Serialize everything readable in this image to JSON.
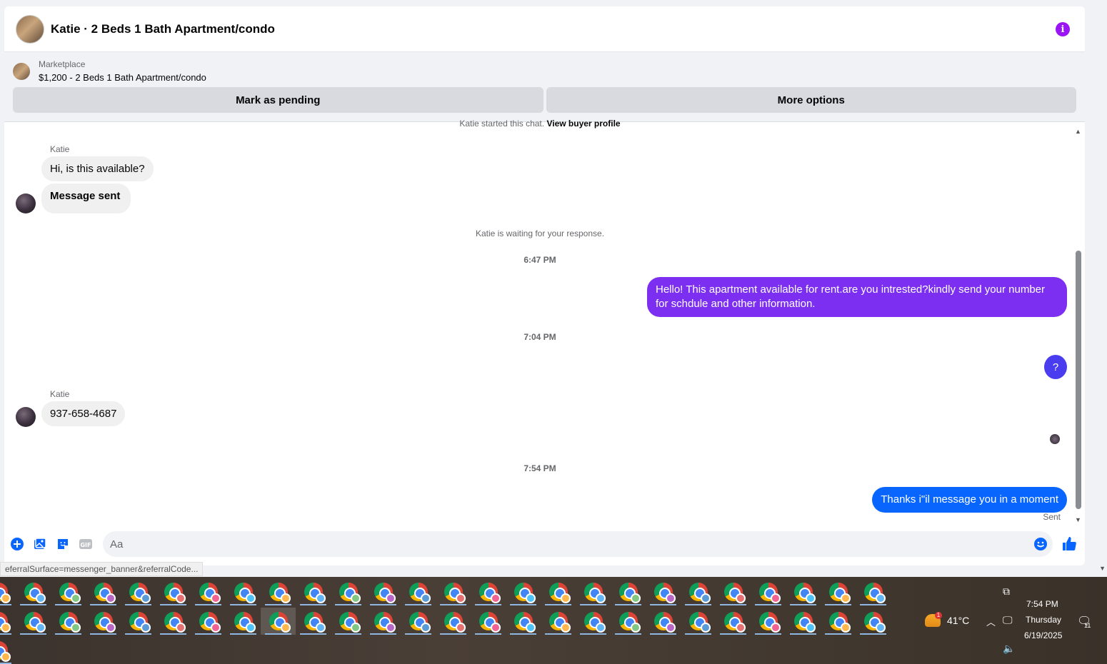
{
  "header": {
    "title": "Katie · 2 Beds 1 Bath Apartment/condo",
    "info_icon": "i"
  },
  "banner": {
    "label": "Marketplace",
    "listing": "$1,200 - 2 Beds 1 Bath Apartment/condo",
    "buttons": [
      "Mark as pending",
      "More options"
    ]
  },
  "thread": {
    "started_note": "Katie started this chat.",
    "view_profile": "View buyer profile",
    "waiting_note": "Katie is waiting for your response.",
    "messages": [
      {
        "sender": "Katie",
        "text": "Hi, is this available?"
      },
      {
        "text": "Message sent"
      },
      {
        "time": "6:47 PM"
      },
      {
        "text": "Hello! This apartment available for rent.are you intrested?kindly send your number for schdule and other information."
      },
      {
        "time": "7:04 PM"
      },
      {
        "text": "?"
      },
      {
        "sender": "Katie",
        "text": "937-658-4687"
      },
      {
        "time": "7:54 PM"
      },
      {
        "text": "Thanks i\"il message you in a moment"
      }
    ],
    "sent_status": "Sent"
  },
  "composer": {
    "placeholder": "Aa"
  },
  "status_url": "eferralSurface=messenger_banner&referralCode...",
  "taskbar": {
    "weather_temp": "41°C",
    "weather_badge": "1",
    "time": "7:54 PM",
    "day": "Thursday",
    "date": "6/19/2025",
    "notification_count": "11"
  },
  "colors": {
    "bubble_purple": "#7c2ff0",
    "bubble_indigo": "#4a3df0",
    "bubble_blue": "#0866ff",
    "accent": "#0866ff"
  }
}
